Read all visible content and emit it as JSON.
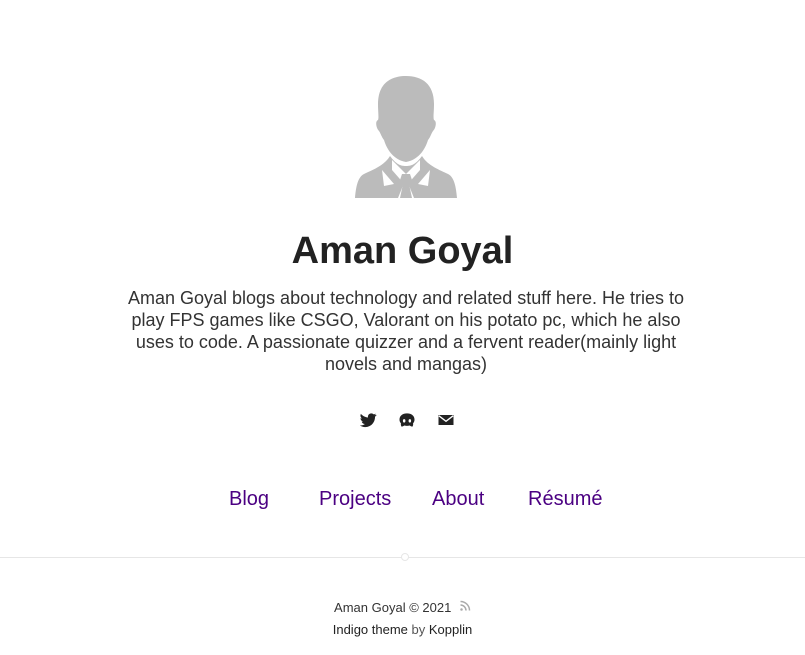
{
  "profile": {
    "name": "Aman Goyal",
    "bio": "Aman Goyal blogs about technology and related stuff here. He tries to play FPS games like CSGO, Valorant on his potato pc, which he also uses to code. A passionate quizzer and a fervent reader(mainly light novels and mangas)",
    "avatar_icon": "person-silhouette-icon"
  },
  "social": [
    {
      "icon": "twitter-icon"
    },
    {
      "icon": "github-icon"
    },
    {
      "icon": "email-icon"
    }
  ],
  "nav": {
    "items": [
      "Blog",
      "Projects",
      "About",
      "Résumé"
    ]
  },
  "footer": {
    "copyright": "Aman Goyal © 2021",
    "rss_icon": "rss-icon",
    "theme_link": "Indigo theme",
    "by": "by",
    "author_link": "Kopplin"
  },
  "colors": {
    "link": "#4b0082",
    "text": "#333333",
    "avatar": "#bbbbbb",
    "divider": "#e6e6e6"
  }
}
